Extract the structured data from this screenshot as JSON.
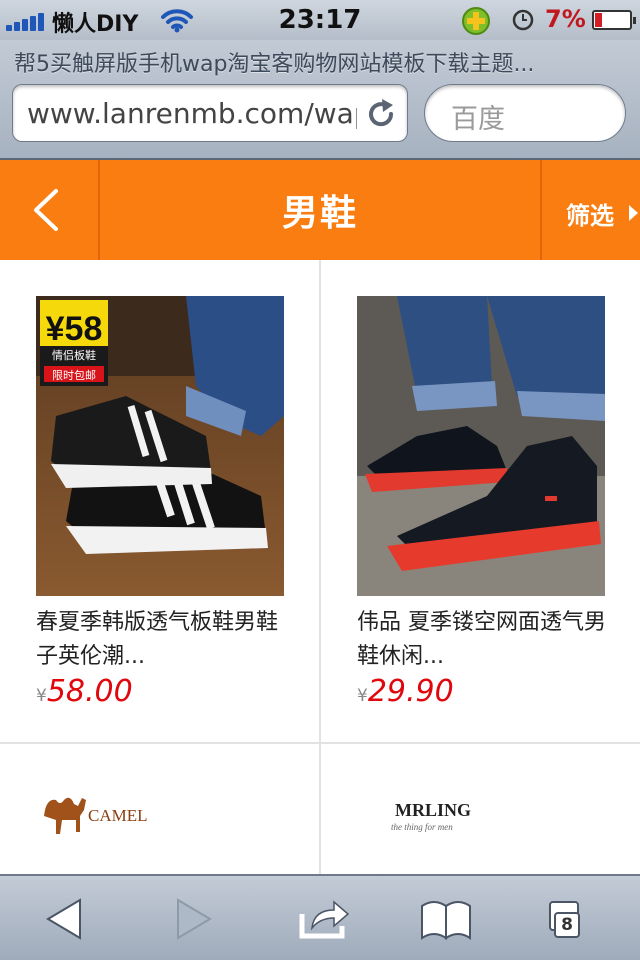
{
  "status_bar": {
    "carrier": "懒人DIY",
    "time": "23:17",
    "battery_percent": "7%",
    "battery_level": 0.07
  },
  "browser": {
    "page_title": "帮5买触屏版手机wap淘宝客购物网站模板下载主题...",
    "url": "www.lanrenmb.com/wap",
    "search_placeholder": "百度"
  },
  "header": {
    "title": "男鞋",
    "filter_label": "筛选"
  },
  "products": [
    {
      "name": "春夏季韩版透气板鞋男鞋子英伦潮...",
      "price_symbol": "¥",
      "price": "58.00",
      "badge_price": "¥58",
      "badge_line1": "情侣板鞋",
      "badge_line2": "限时包邮"
    },
    {
      "name": "伟品 夏季镂空网面透气男鞋休闲...",
      "price_symbol": "¥",
      "price": "29.90"
    }
  ],
  "brands": [
    {
      "name": "CAMEL"
    },
    {
      "name": "MRLING",
      "tagline": "the thing for men"
    }
  ],
  "toolbar": {
    "tabs_count": "8"
  },
  "colors": {
    "accent": "#f97d10",
    "price": "#e0070d"
  }
}
